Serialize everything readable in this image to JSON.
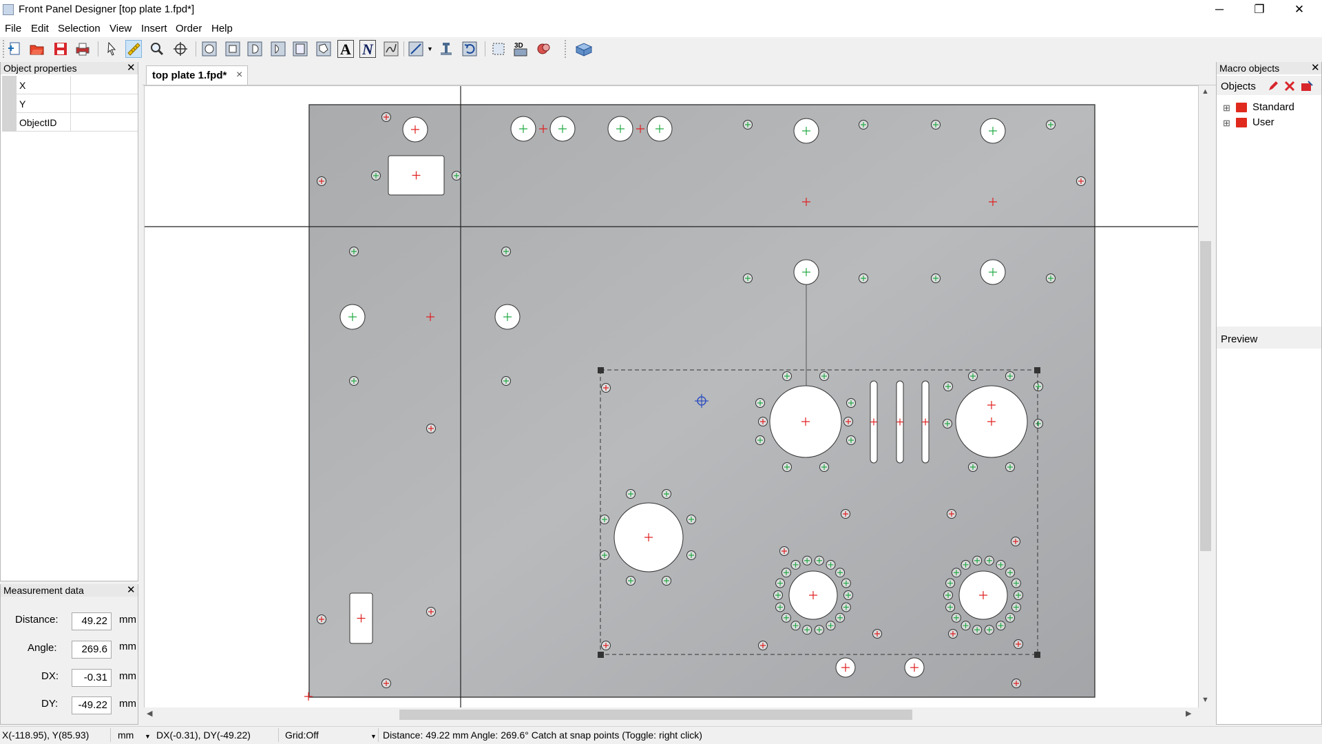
{
  "window": {
    "title": "Front Panel Designer [top plate 1.fpd*]",
    "minimize_glyph": "─",
    "restore_glyph": "❐",
    "close_glyph": "✕"
  },
  "menu": [
    "File",
    "Edit",
    "Selection",
    "View",
    "Insert",
    "Order",
    "Help"
  ],
  "toolbar": {
    "icons": [
      "new-icon",
      "open-icon",
      "save-icon",
      "print-icon",
      "pointer-icon",
      "measure-ruler-icon",
      "zoom-icon",
      "crosshair-icon",
      "circle-hole-icon",
      "rectangle-hole-icon",
      "d-hole-icon",
      "double-d-hole-icon",
      "rect-cutout-icon",
      "freeform-cutout-icon",
      "text-engraving-icon",
      "ntext-engraving-icon",
      "hpgl-import-icon",
      "line-tool-icon",
      "bolt-icon",
      "rotate-icon",
      "select-area-icon",
      "3d-view-icon",
      "materials-icon",
      "order-icon"
    ],
    "text_a": "A",
    "text_n": "N"
  },
  "object_properties": {
    "title": "Object properties",
    "close": "✕",
    "rows": [
      {
        "name": "X",
        "value": ""
      },
      {
        "name": "Y",
        "value": ""
      },
      {
        "name": "ObjectID",
        "value": ""
      }
    ]
  },
  "measurement": {
    "title": "Measurement data",
    "close": "✕",
    "rows": [
      {
        "label": "Distance:",
        "value": "49.22",
        "unit": "mm"
      },
      {
        "label": "Angle:",
        "value": "269.6",
        "unit": "°"
      },
      {
        "label": "DX:",
        "value": "-0.31",
        "unit": "mm"
      },
      {
        "label": "DY:",
        "value": "-49.22",
        "unit": "mm"
      }
    ]
  },
  "document_tab": {
    "label": "top plate 1.fpd*",
    "close": "×"
  },
  "macro_objects": {
    "title": "Macro objects",
    "close": "✕",
    "objects_label": "Objects",
    "tree": [
      {
        "label": "Standard",
        "expander": "⊞"
      },
      {
        "label": "User",
        "expander": "⊞"
      }
    ],
    "preview_label": "Preview"
  },
  "statusbar": {
    "coords": "X(-118.95), Y(85.93)",
    "unit": "mm",
    "delta": "DX(-0.31), DY(-49.22)",
    "grid": "Grid:Off",
    "message": "Distance: 49.22 mm  Angle: 269.6°  Catch at snap points (Toggle: right click)"
  },
  "colors": {
    "plate": "#b0b2b4",
    "hole_fill": "#ffffff",
    "center_mark": "#e02020",
    "snap_mark": "#22aa44",
    "accent": "#0078d7"
  }
}
